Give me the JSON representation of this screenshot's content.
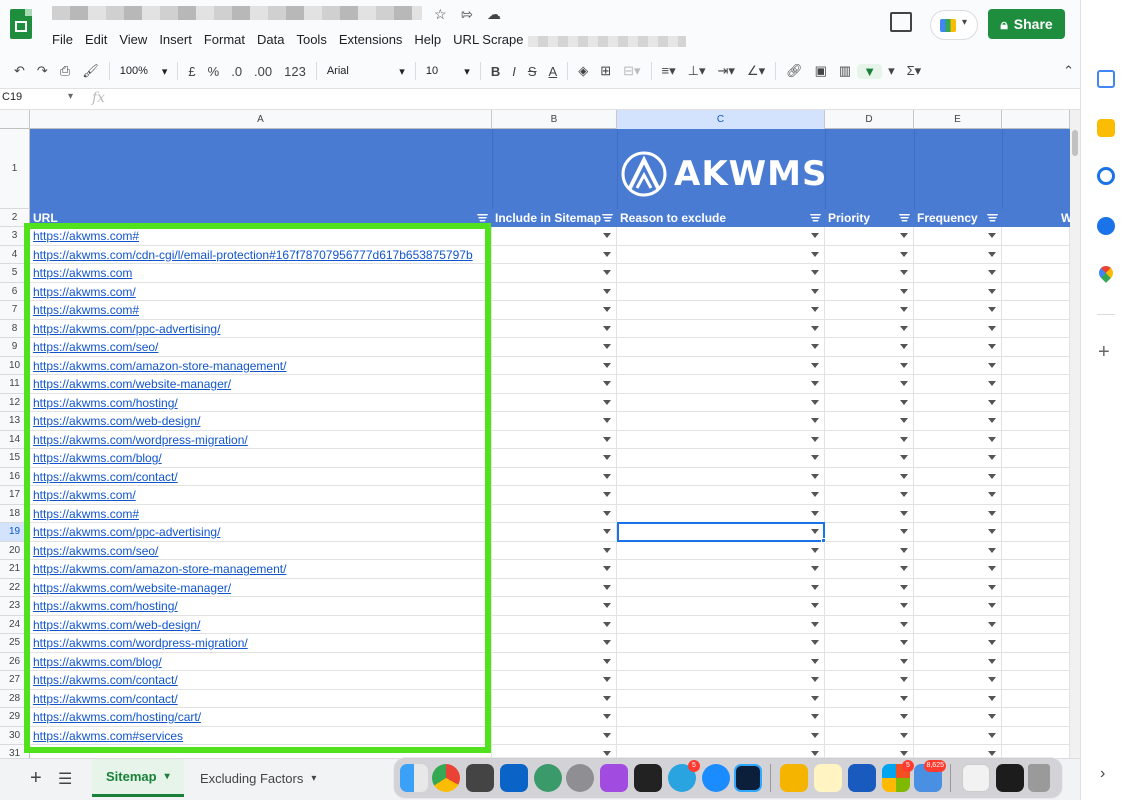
{
  "menubar": [
    "File",
    "Edit",
    "View",
    "Insert",
    "Format",
    "Data",
    "Tools",
    "Extensions",
    "Help",
    "URL Scrape"
  ],
  "share_label": "Share",
  "toolbar": {
    "zoom": "100%",
    "currency": "£",
    "percent": "%",
    "dec_less": ".0",
    "dec_more": ".00",
    "num_format": "123",
    "font": "Arial",
    "font_size": "10",
    "bold": "B",
    "italic": "I",
    "strike": "S",
    "text_color": "A",
    "sum": "Σ"
  },
  "formula": {
    "cell_ref": "C19",
    "fx": "fx",
    "value": ""
  },
  "columns": [
    "A",
    "B",
    "C",
    "D",
    "E"
  ],
  "logo_text": "AKWMS",
  "headers": {
    "url": "URL",
    "include": "Include in Sitemap",
    "reason": "Reason to exclude",
    "priority": "Priority",
    "frequency": "Frequency",
    "extra": "W"
  },
  "row_numbers": [
    "1",
    "2",
    "3",
    "4",
    "5",
    "6",
    "7",
    "8",
    "9",
    "10",
    "11",
    "12",
    "13",
    "14",
    "15",
    "16",
    "17",
    "18",
    "19",
    "20",
    "21",
    "22",
    "23",
    "24",
    "25",
    "26",
    "27",
    "28",
    "29",
    "30",
    "31"
  ],
  "rows": [
    "https://akwms.com#",
    "https://akwms.com/cdn-cgi/l/email-protection#167f78707956777d617b653875797b",
    "https://akwms.com",
    "https://akwms.com/",
    "https://akwms.com#",
    "https://akwms.com/ppc-advertising/",
    "https://akwms.com/seo/",
    "https://akwms.com/amazon-store-management/",
    "https://akwms.com/website-manager/",
    "https://akwms.com/hosting/",
    "https://akwms.com/web-design/",
    "https://akwms.com/wordpress-migration/",
    "https://akwms.com/blog/",
    "https://akwms.com/contact/",
    "https://akwms.com/",
    "https://akwms.com#",
    "https://akwms.com/ppc-advertising/",
    "https://akwms.com/seo/",
    "https://akwms.com/amazon-store-management/",
    "https://akwms.com/website-manager/",
    "https://akwms.com/hosting/",
    "https://akwms.com/web-design/",
    "https://akwms.com/wordpress-migration/",
    "https://akwms.com/blog/",
    "https://akwms.com/contact/",
    "https://akwms.com/contact/",
    "https://akwms.com/hosting/cart/",
    "https://akwms.com#services"
  ],
  "sheets": {
    "active": "Sitemap",
    "other": "Excluding Factors"
  },
  "dock_badges": {
    "telegram": "5",
    "mail": "8,625",
    "ms": "5"
  },
  "colors": {
    "brand_green": "#1e8e3e",
    "banner_blue": "#4a7bd2",
    "highlight_green": "#52e21d",
    "link": "#1155cc"
  }
}
